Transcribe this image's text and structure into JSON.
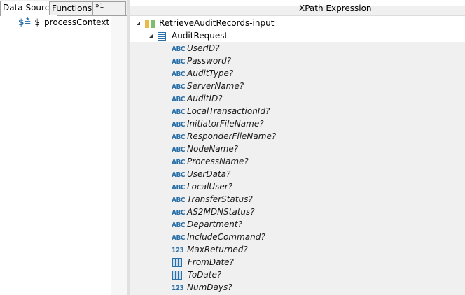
{
  "tabs": {
    "data_source": "Data Source",
    "functions": "Functions",
    "overflow": "1"
  },
  "data_source": {
    "item": "$_processContext",
    "icon": "dollar-variable-icon"
  },
  "header": {
    "title": "XPath Expression"
  },
  "tree": {
    "root": "RetrieveAuditRecords-input",
    "request": "AuditRequest",
    "fields": [
      {
        "name": "UserID?",
        "type": "string"
      },
      {
        "name": "Password?",
        "type": "string"
      },
      {
        "name": "AuditType?",
        "type": "string"
      },
      {
        "name": "ServerName?",
        "type": "string"
      },
      {
        "name": "AuditID?",
        "type": "string"
      },
      {
        "name": "LocalTransactionId?",
        "type": "string"
      },
      {
        "name": "InitiatorFileName?",
        "type": "string"
      },
      {
        "name": "ResponderFileName?",
        "type": "string"
      },
      {
        "name": "NodeName?",
        "type": "string"
      },
      {
        "name": "ProcessName?",
        "type": "string"
      },
      {
        "name": "UserData?",
        "type": "string"
      },
      {
        "name": "LocalUser?",
        "type": "string"
      },
      {
        "name": "TransferStatus?",
        "type": "string"
      },
      {
        "name": "AS2MDNStatus?",
        "type": "string"
      },
      {
        "name": "Department?",
        "type": "string"
      },
      {
        "name": "IncludeCommand?",
        "type": "string"
      },
      {
        "name": "MaxReturned?",
        "type": "integer"
      },
      {
        "name": "FromDate?",
        "type": "date"
      },
      {
        "name": "ToDate?",
        "type": "date"
      },
      {
        "name": "NumDays?",
        "type": "integer"
      }
    ]
  },
  "type_labels": {
    "string": "ABC",
    "integer": "123"
  }
}
